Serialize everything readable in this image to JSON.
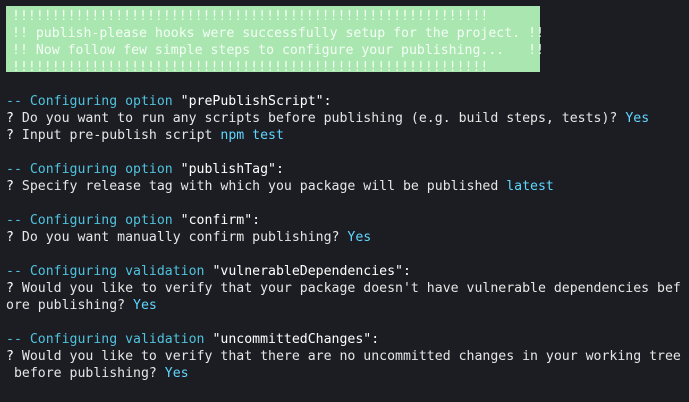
{
  "banner": {
    "lines": [
      "!!!!!!!!!!!!!!!!!!!!!!!!!!!!!!!!!!!!!!!!!!!!!!!!!!!!!!!!!!!!",
      "!! publish-please hooks were successfully setup for the project. !!",
      "!! Now follow few simple steps to configure your publishing...   !!",
      "!!!!!!!!!!!!!!!!!!!!!!!!!!!!!!!!!!!!!!!!!!!!!!!!!!!!!!!!!!!!"
    ]
  },
  "sections": [
    {
      "header_prefix": "-- Configuring option ",
      "header_name": "\"prePublishScript\":",
      "prompts": [
        {
          "mark": "?",
          "text": " Do you want to run any scripts before publishing (e.g. build steps, tests)? ",
          "answer": "Yes"
        },
        {
          "mark": "?",
          "text": " Input pre-publish script ",
          "answer": "npm test"
        }
      ]
    },
    {
      "header_prefix": "-- Configuring option ",
      "header_name": "\"publishTag\":",
      "prompts": [
        {
          "mark": "?",
          "text": " Specify release tag with which you package will be published ",
          "answer": "latest"
        }
      ]
    },
    {
      "header_prefix": "-- Configuring option ",
      "header_name": "\"confirm\":",
      "prompts": [
        {
          "mark": "?",
          "text": " Do you want manually confirm publishing? ",
          "answer": "Yes"
        }
      ]
    },
    {
      "header_prefix": "-- Configuring validation ",
      "header_name": "\"vulnerableDependencies\":",
      "prompts": [
        {
          "mark": "?",
          "text": " Would you like to verify that your package doesn't have vulnerable dependencies bef",
          "answer": ""
        },
        {
          "mark": "",
          "text": "ore publishing? ",
          "answer": "Yes"
        }
      ]
    },
    {
      "header_prefix": "-- Configuring validation ",
      "header_name": "\"uncommittedChanges\":",
      "prompts": [
        {
          "mark": "?",
          "text": " Would you like to verify that there are no uncommitted changes in your working tree",
          "answer": ""
        },
        {
          "mark": "",
          "text": " before publishing? ",
          "answer": "Yes"
        }
      ]
    }
  ],
  "colors": {
    "background": "#1c1c23",
    "banner_bg": "#a9e6b0",
    "header": "#4fc3dd",
    "answer": "#5fd7ff",
    "text": "#e6e6e6"
  }
}
